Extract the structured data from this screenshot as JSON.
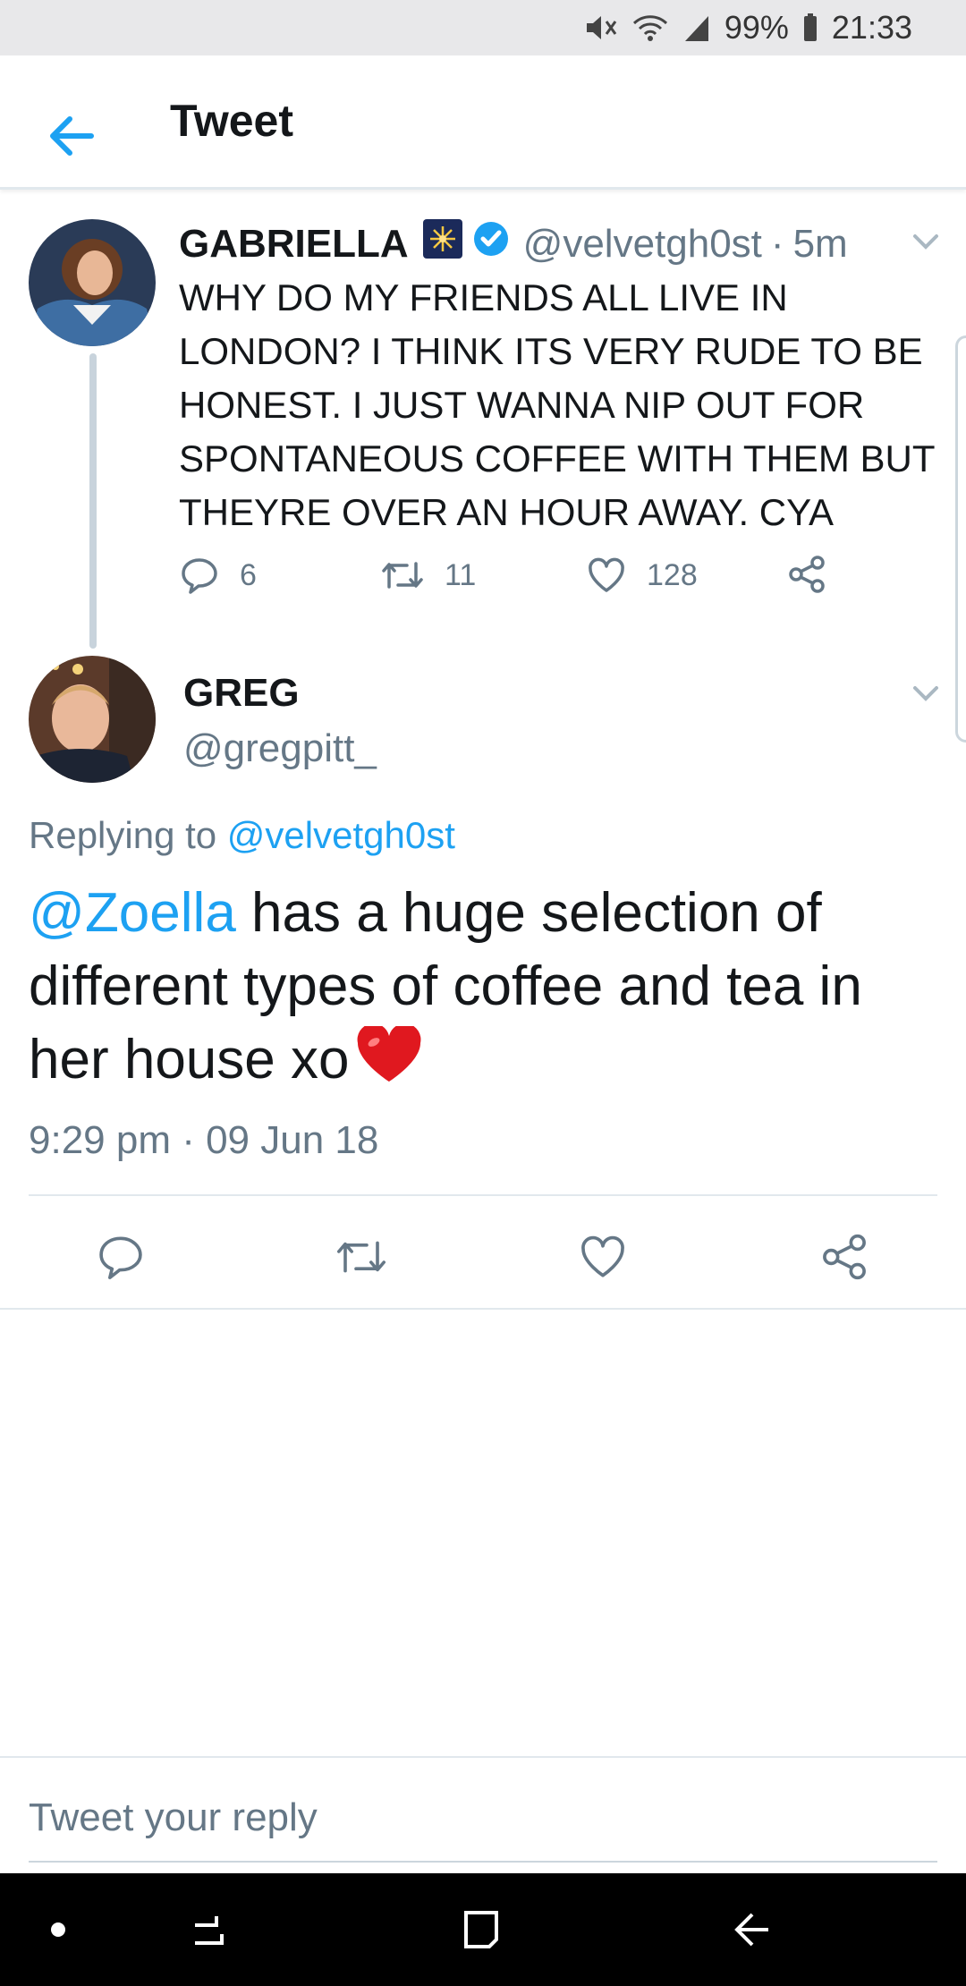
{
  "status_bar": {
    "battery": "99%",
    "time": "21:33"
  },
  "app_bar": {
    "title": "Tweet"
  },
  "parent_tweet": {
    "name": "GABRIELLA",
    "handle": "@velvetgh0st",
    "time_sep": "·",
    "time": "5m",
    "text": "WHY DO MY FRIENDS ALL LIVE IN LONDON? I THINK ITS VERY RUDE TO BE HONEST. I JUST WANNA NIP OUT FOR SPONTANEOUS COFFEE WITH THEM BUT THEYRE OVER AN HOUR AWAY. CYA",
    "reply_count": "6",
    "retweet_count": "11",
    "like_count": "128"
  },
  "main_tweet": {
    "name": "GREG",
    "handle": "@gregpitt_",
    "replying_prefix": "Replying to",
    "replying_to": "@velvetgh0st",
    "mention": "@Zoella",
    "text": " has a huge selection of different types of coffee and tea in her house xo",
    "timestamp": "9:29 pm · 09 Jun 18"
  },
  "reply_bar": {
    "placeholder": "Tweet your reply"
  },
  "colors": {
    "accent": "#1da1f2",
    "muted": "#657786",
    "text": "#14171a",
    "verified": "#1da1f2"
  },
  "icons": {
    "back": "arrow-left-icon",
    "verified": "verified-badge-icon",
    "reply": "comment-icon",
    "retweet": "retweet-icon",
    "like": "heart-icon",
    "share": "share-icon"
  }
}
